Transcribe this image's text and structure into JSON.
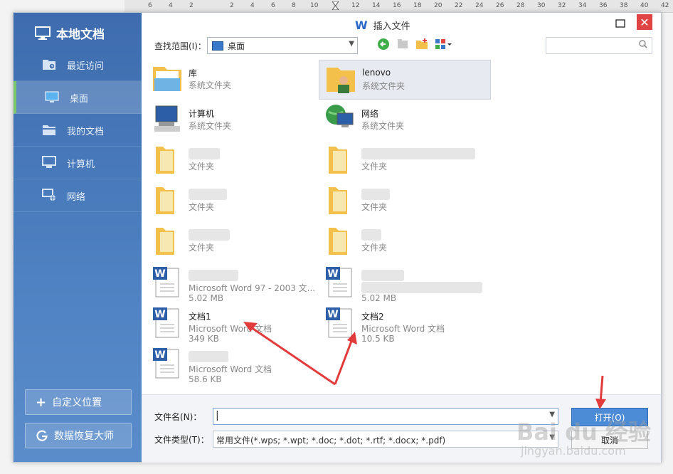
{
  "ruler": {
    "ticks": [
      "6",
      "4",
      "2",
      "2",
      "4",
      "6",
      "8",
      "10",
      "12",
      "14",
      "16",
      "18",
      "20",
      "22",
      "24",
      "26",
      "28",
      "30",
      "32",
      "34",
      "36",
      "38",
      "40",
      "42"
    ]
  },
  "sidebar": {
    "title": "本地文档",
    "items": [
      {
        "label": "最近访问",
        "icon": "recent-folder-icon"
      },
      {
        "label": "桌面",
        "icon": "desktop-icon"
      },
      {
        "label": "我的文档",
        "icon": "documents-folder-icon"
      },
      {
        "label": "计算机",
        "icon": "computer-icon"
      },
      {
        "label": "网络",
        "icon": "network-icon"
      }
    ],
    "active_index": 1,
    "custom_location": "自定义位置",
    "recovery": "数据恢复大师"
  },
  "dialog": {
    "title": "插入文件",
    "lookin_label": "查找范围(I)：",
    "lookin_value": "桌面",
    "search_placeholder": ""
  },
  "files": [
    {
      "name": "库",
      "type": "系统文件夹",
      "size": "",
      "icon": "library-icon"
    },
    {
      "name": "lenovo",
      "type": "系统文件夹",
      "size": "",
      "icon": "user-folder-icon"
    },
    {
      "name": "计算机",
      "type": "系统文件夹",
      "size": "",
      "icon": "computer-icon"
    },
    {
      "name": "网络",
      "type": "系统文件夹",
      "size": "",
      "icon": "network-icon"
    },
    {
      "name": "",
      "type": "文件夹",
      "size": "",
      "icon": "folder-icon"
    },
    {
      "name": "",
      "type": "文件夹",
      "size": "",
      "icon": "folder-icon"
    },
    {
      "name": "",
      "type": "文件夹",
      "size": "",
      "icon": "folder-icon"
    },
    {
      "name": "",
      "type": "文件夹",
      "size": "",
      "icon": "folder-icon"
    },
    {
      "name": "",
      "type": "文件夹",
      "size": "",
      "icon": "folder-icon"
    },
    {
      "name": "",
      "type": "文件夹",
      "size": "",
      "icon": "folder-icon"
    },
    {
      "name": "",
      "type": "Microsoft Word 97 - 2003 文...",
      "size": "5.02 MB",
      "icon": "word-doc-icon"
    },
    {
      "name": "",
      "type": "",
      "size": "5.02 MB",
      "icon": "word-doc-icon"
    },
    {
      "name": "文档1",
      "type": "Microsoft Word 文档",
      "size": "349 KB",
      "icon": "word-doc-icon"
    },
    {
      "name": "文档2",
      "type": "Microsoft Word 文档",
      "size": "10.5 KB",
      "icon": "word-doc-icon"
    },
    {
      "name": "",
      "type": "Microsoft Word 文档",
      "size": "58.6 KB",
      "icon": "word-doc-icon"
    }
  ],
  "bottom": {
    "filename_label": "文件名(N)：",
    "filename_value": "",
    "filetype_label": "文件类型(T)：",
    "filetype_value": "常用文件(*.wps; *.wpt; *.doc; *.dot; *.rtf; *.docx; *.pdf)",
    "open_label": "打开(O)",
    "cancel_label": "取消"
  },
  "watermark": {
    "text": "Bai du 经验",
    "url": "jingyan.baidu.com"
  },
  "colors": {
    "sidebar": "#4a78b8",
    "accent": "#4c8bd6",
    "close": "#e04343",
    "active_bar": "#7ec86b",
    "arrow": "#e23b3b"
  }
}
